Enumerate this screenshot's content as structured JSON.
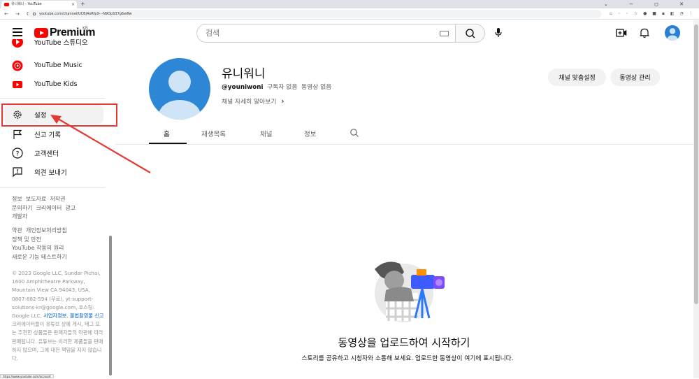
{
  "browser": {
    "tab_title": "유니워니 - YouTube",
    "tab_close": "×",
    "new_tab": "+",
    "window_controls": "⌄ − ◻ ✕",
    "nav_buttons": "← → C",
    "url": "youtube.com/channel/UCBj4oRfpX---N9OpS37g6w8w",
    "status_url": "https://www.youtube.com/account"
  },
  "header": {
    "logo_text": "Premium",
    "logo_region": "KR",
    "search_placeholder": "검색"
  },
  "sidebar": {
    "partial_item": "YouTube 스튜디오",
    "items": [
      {
        "label": "YouTube Music",
        "icon": "youtube-music-icon"
      },
      {
        "label": "YouTube Kids",
        "icon": "youtube-kids-icon"
      },
      {
        "label": "설정",
        "icon": "gear-icon"
      },
      {
        "label": "신고 기록",
        "icon": "flag-icon"
      },
      {
        "label": "고객센터",
        "icon": "help-icon"
      },
      {
        "label": "의견 보내기",
        "icon": "feedback-icon"
      }
    ],
    "footer1": [
      "정보",
      "보도자료",
      "저작권",
      "문의하기",
      "크리에이터",
      "광고",
      "개발자"
    ],
    "footer2": [
      "약관",
      "개인정보처리방침",
      "정책 및 안전",
      "YouTube 작동의 원리",
      "새로운 기능 테스트하기"
    ],
    "copyright": "© 2023 Google LLC, Sundar Pichai, 1600 Amphitheatre Parkway, Mountain View CA 94043, USA, 0807-882-594 (무료), yt-support-solutions-kr@google.com, 호스팅: Google LLC,",
    "link1": "사업자정보",
    "link_sep": ", ",
    "link2": "불법촬영물 신고",
    "disclaimer": "크리에이터들이 유튜브 상에 게시, 태그 또는 추천한 상품들은 판매자들의 약관에 따라 판매됩니다. 유튜브는 이러한 제품들을 판매하지 않으며, 그에 대한 책임을 지지 않습니다."
  },
  "channel": {
    "name": "유니워니",
    "handle": "@youniwoni",
    "subscribers": "구독자 없음",
    "videos": "동영상 없음",
    "more": "채널 자세히 알아보기",
    "more_chevron": "›",
    "btn_customize": "채널 맞춤설정",
    "btn_manage": "동영상 관리",
    "tabs": [
      "홈",
      "재생목록",
      "채널",
      "정보"
    ]
  },
  "empty": {
    "title": "동영상을 업로드하여 시작하기",
    "desc": "스토리를 공유하고 시청자와 소통해 보세요. 업로드한 동영상이 여기에 표시됩니다."
  },
  "colors": {
    "brand": "#ff0000",
    "annotation": "#e53935",
    "avatar": "#2d86d6"
  }
}
